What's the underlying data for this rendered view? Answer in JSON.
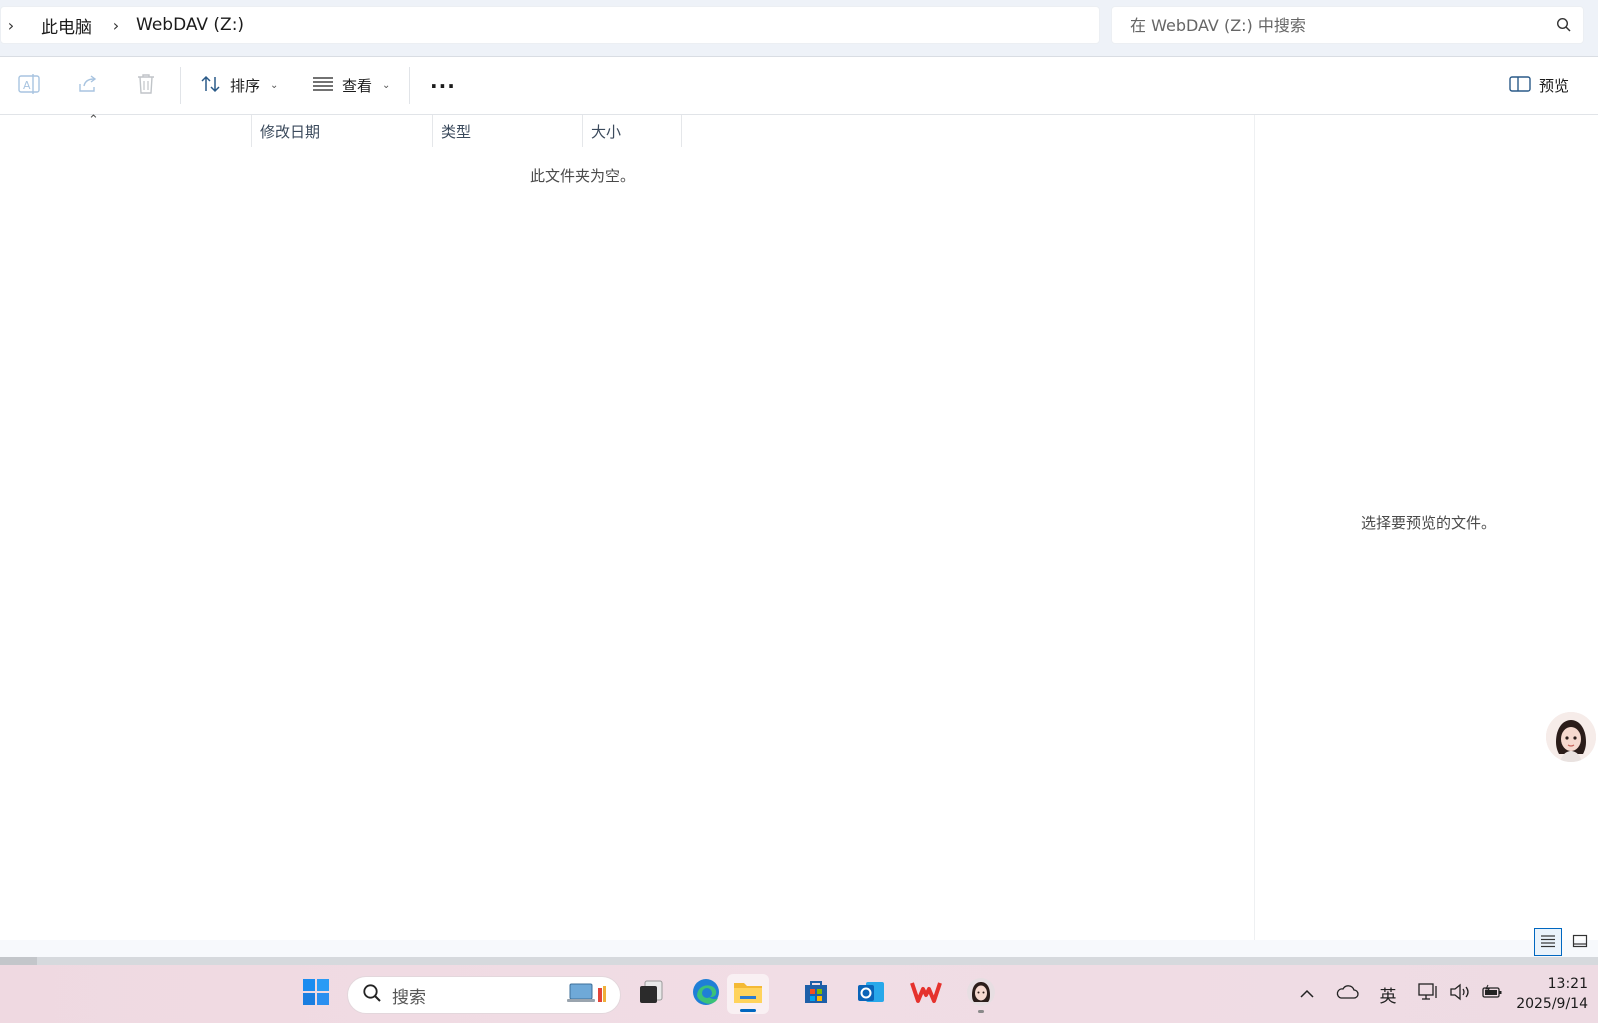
{
  "breadcrumb": {
    "items": [
      "此电脑",
      "WebDAV (Z:)"
    ]
  },
  "search": {
    "placeholder": "在 WebDAV (Z:) 中搜索"
  },
  "commandbar": {
    "sort_label": "排序",
    "view_label": "查看",
    "more_label": "···",
    "preview_label": "预览"
  },
  "columns": [
    "修改日期",
    "类型",
    "大小"
  ],
  "content": {
    "empty_message": "此文件夹为空。"
  },
  "preview": {
    "message": "选择要预览的文件。"
  },
  "taskbar": {
    "search_label": "搜索",
    "apps": [
      "start-icon",
      "widgets-icon",
      "task-view-icon",
      "edge-icon",
      "file-explorer-icon",
      "store-icon",
      "outlook-icon",
      "wps-icon",
      "assistant-avatar-icon"
    ]
  },
  "tray": {
    "ime_label": "英",
    "time": "13:21",
    "date": "2025/9/14"
  },
  "colors": {
    "accent": "#0067c0",
    "taskbar_bg": "#efd9e1"
  }
}
